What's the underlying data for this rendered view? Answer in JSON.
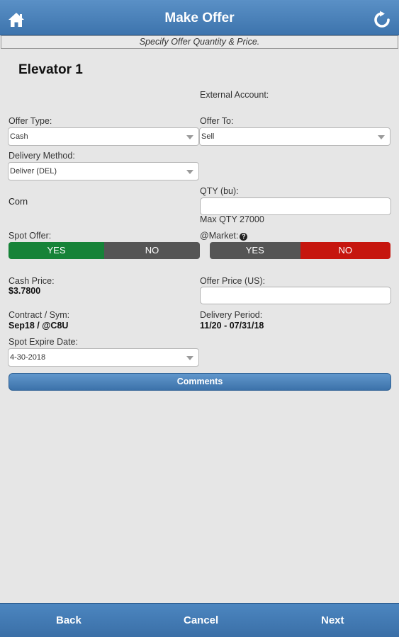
{
  "header": {
    "title": "Make Offer",
    "home_icon": "home-icon",
    "refresh_icon": "refresh-icon"
  },
  "subheader": {
    "text": "Specify Offer Quantity & Price."
  },
  "elevator": {
    "name": "Elevator 1"
  },
  "external_account": {
    "label": "External Account:"
  },
  "offer_type": {
    "label": "Offer Type:",
    "value": "Cash"
  },
  "offer_to": {
    "label": "Offer To:",
    "value": "Sell"
  },
  "delivery_method": {
    "label": "Delivery Method:",
    "value": "Deliver (DEL)"
  },
  "commodity": {
    "name": "Corn"
  },
  "qty": {
    "label": "QTY (bu):",
    "value": "",
    "max_text": "Max QTY 27000"
  },
  "spot_offer": {
    "label": "Spot Offer:",
    "yes": "YES",
    "no": "NO",
    "selected": "YES"
  },
  "at_market": {
    "label": "@Market:",
    "help_icon": "question-circle-icon",
    "yes": "YES",
    "no": "NO",
    "selected": "NO"
  },
  "cash_price": {
    "label": "Cash Price:",
    "value": "$3.7800"
  },
  "offer_price": {
    "label": "Offer Price (US):",
    "value": ""
  },
  "contract": {
    "label": "Contract / Sym:",
    "value": "Sep18 / @C8U"
  },
  "delivery_period": {
    "label": "Delivery Period:",
    "value": "11/20 - 07/31/18"
  },
  "spot_expire": {
    "label": "Spot Expire Date:",
    "value": "4-30-2018"
  },
  "comments_button": {
    "label": "Comments"
  },
  "footer": {
    "back": "Back",
    "cancel": "Cancel",
    "next": "Next"
  },
  "colors": {
    "header": "#4a84be",
    "yes_active": "#168338",
    "no_active": "#c6160e",
    "inactive": "#555555",
    "background": "#e6e6e6"
  }
}
